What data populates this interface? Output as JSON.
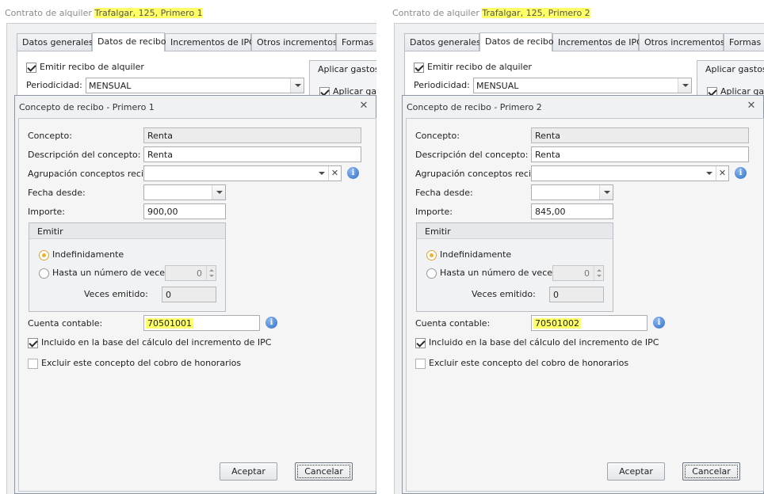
{
  "panels": [
    {
      "window_title_prefix": "Contrato de alquiler",
      "window_title_highlight": "Trafalgar, 125, Primero 1",
      "tabs": [
        "Datos generales",
        "Datos de recibo",
        "Incrementos de IPC",
        "Otros incrementos",
        "Formas de"
      ],
      "emitir_recibo_label": "Emitir recibo de alquiler",
      "periodicidad_label": "Periodicidad:",
      "periodicidad_value": "MENSUAL",
      "aplicar_gastos_label": "Aplicar gastos c",
      "aplicar_gastos_check_label": "Aplicar gast",
      "dialog": {
        "title": "Concepto de recibo - Primero 1",
        "concepto_label": "Concepto:",
        "concepto_value": "Renta",
        "descripcion_label": "Descripción del concepto:",
        "descripcion_value": "Renta",
        "agrupacion_label": "Agrupación conceptos recibo:",
        "agrupacion_value": "",
        "fecha_label": "Fecha desde:",
        "fecha_value": "",
        "importe_label": "Importe:",
        "importe_value": "900,00",
        "emitir_group_label": "Emitir",
        "indefinidamente_label": "Indefinidamente",
        "hasta_label": "Hasta un número de veces",
        "hasta_value": "0",
        "veces_label": "Veces emitido:",
        "veces_value": "0",
        "cuenta_label": "Cuenta contable:",
        "cuenta_value": "70501001",
        "incluido_label": "Incluido en la base del cálculo del incremento de IPC",
        "excluir_label": "Excluir este concepto del cobro de honorarios",
        "aceptar_label": "Aceptar",
        "cancelar_label": "Cancelar"
      }
    },
    {
      "window_title_prefix": "Contrato de alquiler",
      "window_title_highlight": "Trafalgar, 125, Primero 2",
      "tabs": [
        "Datos generales",
        "Datos de recibo",
        "Incrementos de IPC",
        "Otros incrementos",
        "Formas de"
      ],
      "emitir_recibo_label": "Emitir recibo de alquiler",
      "periodicidad_label": "Periodicidad:",
      "periodicidad_value": "MENSUAL",
      "aplicar_gastos_label": "Aplicar gastos c",
      "aplicar_gastos_check_label": "Aplicar gast",
      "dialog": {
        "title": "Concepto de recibo - Primero 2",
        "concepto_label": "Concepto:",
        "concepto_value": "Renta",
        "descripcion_label": "Descripción del concepto:",
        "descripcion_value": "Renta",
        "agrupacion_label": "Agrupación conceptos recibo:",
        "agrupacion_value": "",
        "fecha_label": "Fecha desde:",
        "fecha_value": "",
        "importe_label": "Importe:",
        "importe_value": "845,00",
        "emitir_group_label": "Emitir",
        "indefinidamente_label": "Indefinidamente",
        "hasta_label": "Hasta un número de veces",
        "hasta_value": "0",
        "veces_label": "Veces emitido:",
        "veces_value": "0",
        "cuenta_label": "Cuenta contable:",
        "cuenta_value": "70501002",
        "incluido_label": "Incluido en la base del cálculo del incremento de IPC",
        "excluir_label": "Excluir este concepto del cobro de honorarios",
        "aceptar_label": "Aceptar",
        "cancelar_label": "Cancelar"
      }
    }
  ],
  "colors": {
    "highlight": "#ffff66",
    "accent_radio": "#f0b12e",
    "info_icon": "#2f6fc6"
  },
  "icons": {
    "close": "close-icon",
    "info": "info-icon",
    "dropdown": "chevron-down-icon",
    "clear": "clear-x-icon"
  }
}
